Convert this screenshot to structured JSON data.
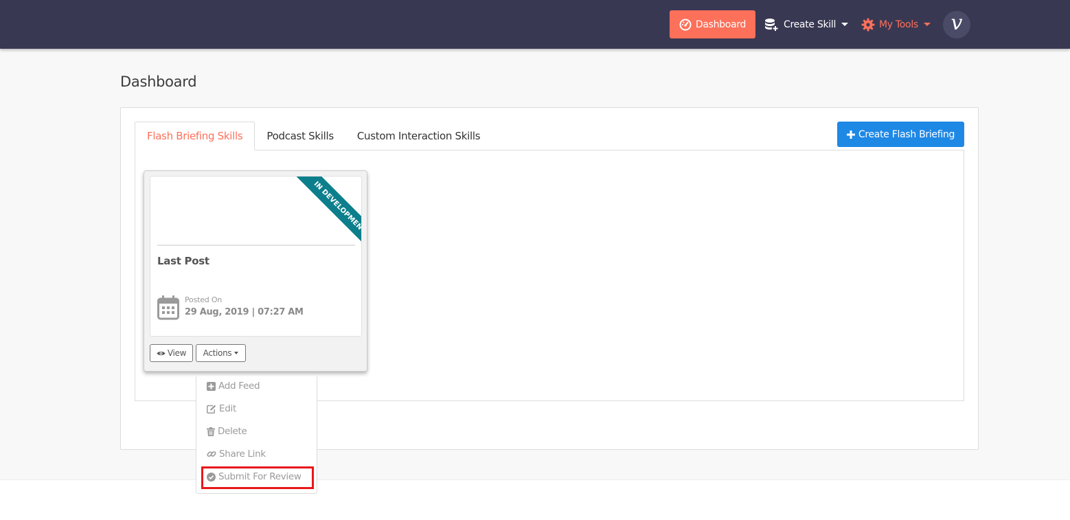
{
  "nav": {
    "dashboard_label": "Dashboard",
    "create_skill_label": "Create Skill",
    "my_tools_label": "My Tools",
    "avatar_letter": "V"
  },
  "page": {
    "title": "Dashboard"
  },
  "tabs": {
    "items": [
      {
        "label": "Flash Briefing Skills",
        "active": true
      },
      {
        "label": "Podcast Skills",
        "active": false
      },
      {
        "label": "Custom Interaction Skills",
        "active": false
      }
    ],
    "create_button_label": "Create Flash Briefing"
  },
  "card": {
    "ribbon": "IN DEVELOPMENT",
    "title": "Last Post",
    "posted_label": "Posted On",
    "posted_date": "29 Aug, 2019 | 07:27 AM",
    "view_label": "View",
    "actions_label": "Actions"
  },
  "actions_menu": {
    "items": [
      {
        "label": "Add Feed",
        "icon": "plus-square-icon"
      },
      {
        "label": "Edit",
        "icon": "edit-icon"
      },
      {
        "label": "Delete",
        "icon": "trash-icon"
      },
      {
        "label": "Share Link",
        "icon": "link-icon"
      },
      {
        "label": "Submit For Review",
        "icon": "check-circle-icon"
      }
    ]
  },
  "colors": {
    "topbar": "#393853",
    "accent": "#fd705a",
    "primary_button": "#1e88e5",
    "ribbon": "#0d7f8c",
    "highlight": "#e8171b"
  }
}
